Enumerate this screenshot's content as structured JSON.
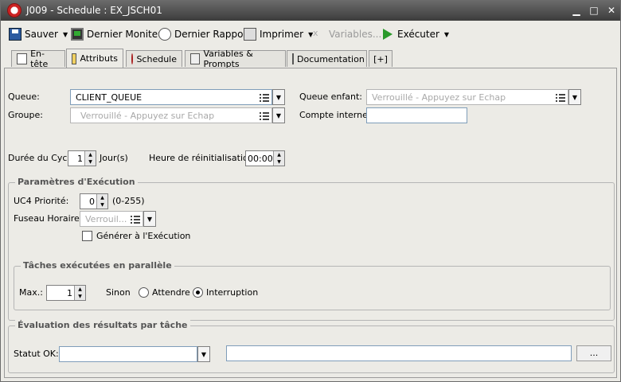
{
  "window": {
    "title": "J009 - Schedule : EX_JSCH01",
    "minimize": "▁",
    "maximize": "□",
    "close": "✕"
  },
  "toolbar": {
    "save": "Sauver",
    "last_monitor": "Dernier Moniteur",
    "last_report": "Dernier Rapport",
    "print": "Imprimer",
    "variables": "Variables...",
    "execute": "Exécuter"
  },
  "tabs": {
    "header": "En-tête",
    "attributes": "Attributs",
    "schedule": "Schedule",
    "variables": "Variables & Prompts",
    "documentation": "Documentation",
    "add": "[+]"
  },
  "form": {
    "queue_label": "Queue:",
    "queue_value": "CLIENT_QUEUE",
    "child_queue_label": "Queue enfant:",
    "child_queue_value": "Verrouillé - Appuyez sur Echap",
    "group_label": "Groupe:",
    "group_value": "Verrouillé - Appuyez sur Echap",
    "internal_account_label": "Compte interne:",
    "internal_account_value": "",
    "cycle_label": "Durée du Cycle",
    "cycle_value": "1",
    "cycle_unit": "Jour(s)",
    "reset_label": "Heure de réinitialisation:",
    "reset_value": "00:00"
  },
  "exec": {
    "title": "Paramètres d'Exécution",
    "priority_label": "UC4 Priorité:",
    "priority_value": "0",
    "priority_range": "(0-255)",
    "timezone_label": "Fuseau Horaire:",
    "timezone_value": "Verrouil...",
    "generate_label": "Générer à l'Exécution"
  },
  "parallel": {
    "title": "Tâches exécutées en parallèle",
    "max_label": "Max.:",
    "max_value": "1",
    "else_label": "Sinon",
    "wait_label": "Attendre",
    "abort_label": "Interruption"
  },
  "eval": {
    "title": "Évaluation des résultats par tâche",
    "status_label": "Statut OK:",
    "status_value": "",
    "text_value": "",
    "browse": "..."
  }
}
